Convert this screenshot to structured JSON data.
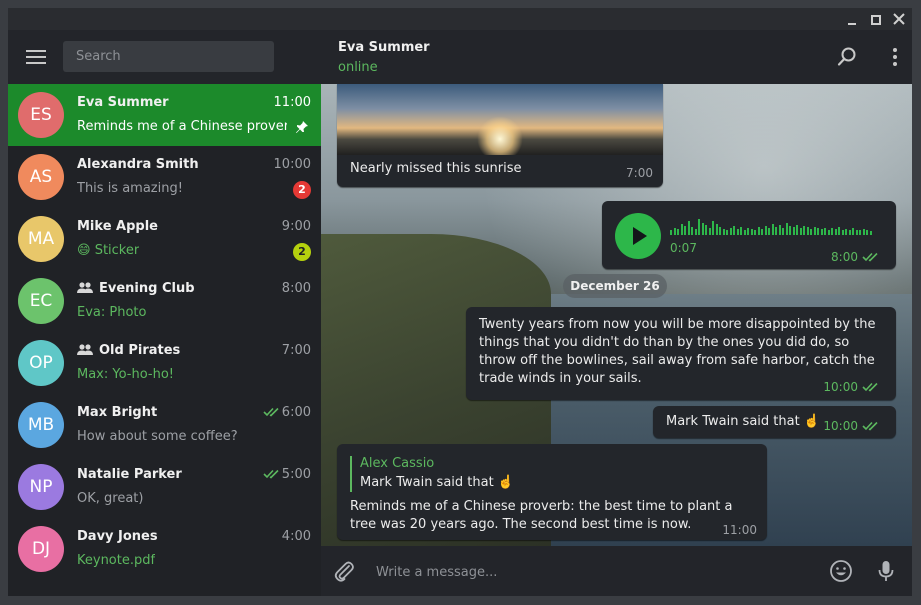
{
  "window": {
    "controls": [
      "minimize",
      "maximize",
      "close"
    ]
  },
  "sidebar": {
    "search_placeholder": "Search",
    "chats": [
      {
        "initials": "ES",
        "avatar_color": "#e06c6c",
        "name": "Eva Summer",
        "time": "11:00",
        "preview": "Reminds me of a Chinese prover…",
        "active": true,
        "pinned": true
      },
      {
        "initials": "AS",
        "avatar_color": "#f08a5d",
        "name": "Alexandra Smith",
        "time": "10:00",
        "preview": "This is amazing!",
        "badge": "2",
        "badge_color": "#e53935"
      },
      {
        "initials": "MA",
        "avatar_color": "#e8c76a",
        "name": "Mike Apple",
        "time": "9:00",
        "preview_emoji": "😄",
        "preview": "Sticker",
        "preview_accent": true,
        "badge": "2",
        "badge_color": "#b5d10e"
      },
      {
        "initials": "EC",
        "avatar_color": "#6cc36c",
        "name": "Evening Club",
        "group": true,
        "time": "8:00",
        "preview": "Eva: Photo",
        "preview_accent": true
      },
      {
        "initials": "OP",
        "avatar_color": "#5fc7c7",
        "name": "Old Pirates",
        "group": true,
        "time": "7:00",
        "preview": "Max: Yo-ho-ho!",
        "preview_accent": true
      },
      {
        "initials": "MB",
        "avatar_color": "#5ba7e0",
        "name": "Max Bright",
        "time": "6:00",
        "preview": "How about some coffee?",
        "read": true
      },
      {
        "initials": "NP",
        "avatar_color": "#9b7ae0",
        "name": "Natalie Parker",
        "time": "5:00",
        "preview": "OK, great)",
        "read": true
      },
      {
        "initials": "DJ",
        "avatar_color": "#e86fa3",
        "name": "Davy Jones",
        "time": "4:00",
        "preview": "Keynote.pdf",
        "preview_accent": true
      }
    ]
  },
  "header": {
    "peer_name": "Eva Summer",
    "peer_status": "online",
    "icons": [
      "search-icon",
      "more-vertical-icon"
    ]
  },
  "messages": {
    "photo": {
      "caption": "Nearly missed this sunrise",
      "time": "7:00"
    },
    "voice": {
      "duration": "0:07",
      "time": "8:00",
      "progress": 0
    },
    "date_separator": "December 26",
    "out1": {
      "text": "Twenty years from now you will be more disappointed by the things that you didn't do than by the ones you did do, so throw off the bowlines, sail away from safe harbor, catch the trade winds in your sails.",
      "time": "10:00"
    },
    "out2": {
      "text": "Mark Twain said that ☝️",
      "time": "10:00"
    },
    "in_reply": {
      "reply_author": "Alex Cassio",
      "reply_text": "Mark Twain said that ☝️",
      "text": "Reminds me of a Chinese proverb: the best time to plant a tree was 20 years ago. The second best time is now.",
      "time": "11:00"
    }
  },
  "composer": {
    "placeholder": "Write a message...",
    "icons": [
      "paperclip-icon",
      "emoji-icon",
      "microphone-icon"
    ]
  },
  "colors": {
    "accent_green": "#5cb85f",
    "active_chat_bg": "#1c8a2b",
    "sidebar_bg": "#202226",
    "bubble_bg": "#23262b"
  }
}
